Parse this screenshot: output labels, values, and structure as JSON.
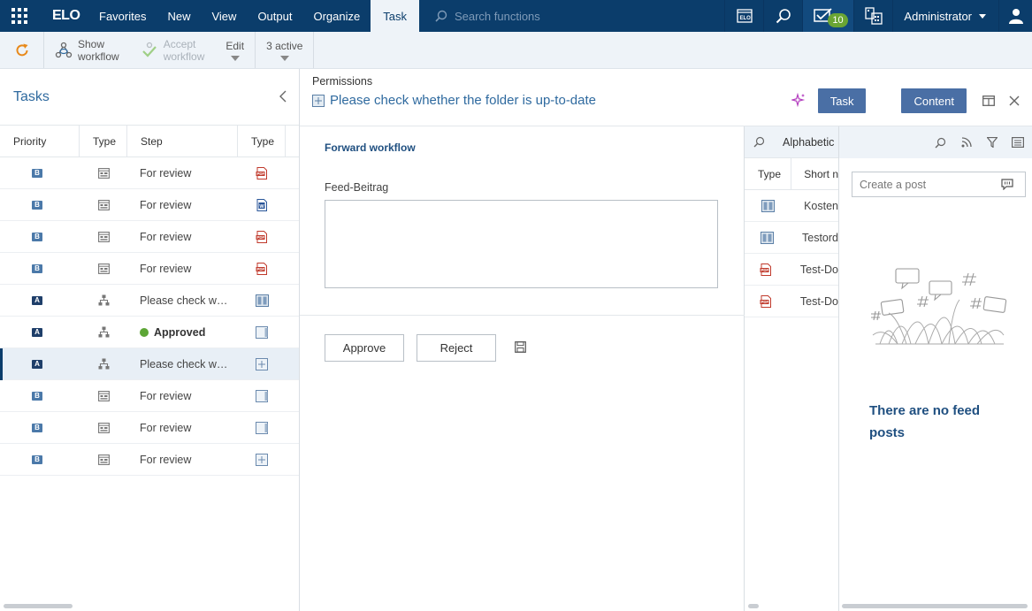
{
  "topbar": {
    "logo": "ELO",
    "menu": [
      "Favorites",
      "New",
      "View",
      "Output",
      "Organize",
      "Task"
    ],
    "active_menu": "Task",
    "search_placeholder": "Search functions",
    "inbox_count": "10",
    "user": "Administrator"
  },
  "toolbar": {
    "show_workflow_1": "Show",
    "show_workflow_2": "workflow",
    "accept_workflow_1": "Accept",
    "accept_workflow_2": "workflow",
    "edit": "Edit",
    "active": "3 active"
  },
  "tasks": {
    "title": "Tasks",
    "columns": [
      "Priority",
      "Type",
      "Step",
      "Type"
    ],
    "rows": [
      {
        "priority": "B",
        "type_icon": "form-icon",
        "step": "For review",
        "doc_icon": "pdf-icon"
      },
      {
        "priority": "B",
        "type_icon": "form-icon",
        "step": "For review",
        "doc_icon": "word-icon"
      },
      {
        "priority": "B",
        "type_icon": "form-icon",
        "step": "For review",
        "doc_icon": "pdf-icon"
      },
      {
        "priority": "B",
        "type_icon": "form-icon",
        "step": "For review",
        "doc_icon": "pdf-icon"
      },
      {
        "priority": "A",
        "type_icon": "workflow-icon",
        "step": "Please check w…",
        "doc_icon": "cabinet-icon"
      },
      {
        "priority": "A",
        "type_icon": "workflow-icon",
        "step": "Approved",
        "doc_icon": "folder-icon",
        "status": "approved"
      },
      {
        "priority": "A",
        "type_icon": "workflow-icon",
        "step": "Please check w…",
        "doc_icon": "register-icon",
        "selected": true
      },
      {
        "priority": "B",
        "type_icon": "form-icon",
        "step": "For review",
        "doc_icon": "folder-icon"
      },
      {
        "priority": "B",
        "type_icon": "form-icon",
        "step": "For review",
        "doc_icon": "folder-icon"
      },
      {
        "priority": "B",
        "type_icon": "form-icon",
        "step": "For review",
        "doc_icon": "register-icon"
      }
    ]
  },
  "detail": {
    "breadcrumb": "Permissions",
    "title": "Please check whether the folder is up-to-date",
    "task_button": "Task",
    "content_button": "Content",
    "forward_workflow": "Forward workflow",
    "feed_label": "Feed-Beitrag",
    "feed_value": "",
    "approve": "Approve",
    "reject": "Reject"
  },
  "list": {
    "search_label": "Alphabetic",
    "columns": [
      "Type",
      "Short n"
    ],
    "rows": [
      {
        "icon": "cabinet-icon",
        "name": "Kosten"
      },
      {
        "icon": "cabinet-icon",
        "name": "Testord"
      },
      {
        "icon": "pdf-icon",
        "name": "Test-Do"
      },
      {
        "icon": "pdf-icon",
        "name": "Test-Do"
      }
    ]
  },
  "feed": {
    "placeholder": "Create a post",
    "empty_text": "There are no feed posts"
  },
  "colors": {
    "nav": "#0b3d6b",
    "accent": "#4a6fa5",
    "badge": "#6aa534",
    "approved": "#5da636"
  }
}
